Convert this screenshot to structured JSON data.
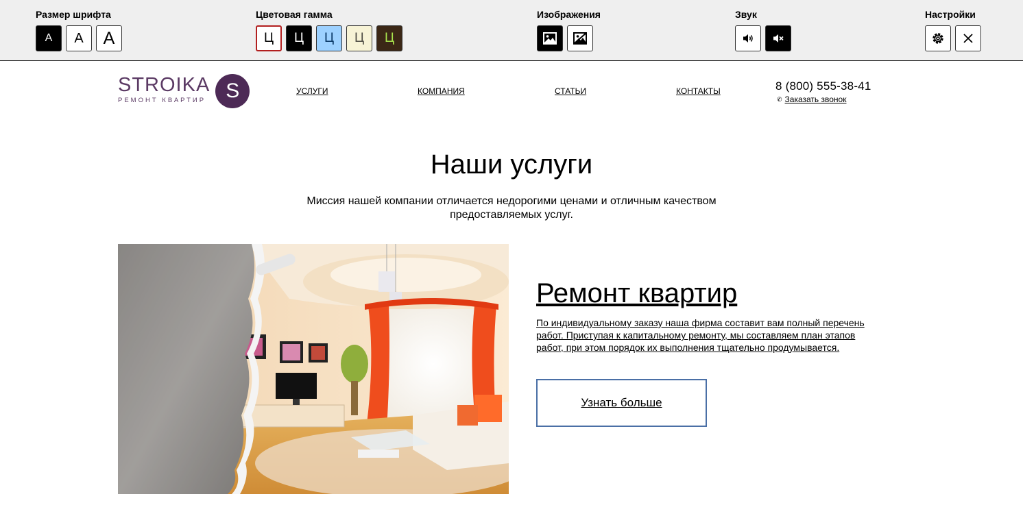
{
  "a11y_panel": {
    "font_size": {
      "title": "Размер шрифта",
      "buttons": [
        "A",
        "A",
        "A"
      ]
    },
    "color_scheme": {
      "title": "Цветовая гамма",
      "buttons": [
        {
          "label": "Ц",
          "bg": "#ffffff",
          "fg": "#000000"
        },
        {
          "label": "Ц",
          "bg": "#000000",
          "fg": "#ffffff"
        },
        {
          "label": "Ц",
          "bg": "#9dd1ff",
          "fg": "#063462"
        },
        {
          "label": "Ц",
          "bg": "#f7f3d6",
          "fg": "#4d4b43"
        },
        {
          "label": "Ц",
          "bg": "#3b2716",
          "fg": "#a9e44d"
        }
      ],
      "selected_border": "#b21f1f"
    },
    "images": {
      "title": "Изображения",
      "buttons": [
        "image-on-icon",
        "image-off-icon"
      ]
    },
    "sound": {
      "title": "Звук",
      "buttons": [
        "sound-on-icon",
        "sound-off-icon"
      ]
    },
    "settings": {
      "title": "Настройки",
      "buttons": [
        "gear-icon",
        "close-icon"
      ]
    }
  },
  "header": {
    "logo": {
      "word": "STROIKA",
      "subtitle": "РЕМОНТ КВАРТИР",
      "letter": "S",
      "brand_color": "#4d2a56"
    },
    "nav": [
      "УСЛУГИ",
      "КОМПАНИЯ",
      "СТАТЬИ",
      "КОНТАКТЫ"
    ],
    "phone": "8 (800) 555-38-41",
    "callback": "Заказать звонок"
  },
  "main": {
    "title": "Наши услуги",
    "mission": "Миссия нашей компании отличается недорогими ценами и отличным качеством предоставляемых услуг.",
    "service": {
      "title": "Ремонт квартир",
      "description": "По индивидуальному заказу наша фирма составит вам полный перечень работ. Приступая к капитальному ремонту, мы составляем план этапов работ, при этом порядок их выполнения тщательно продумывается.",
      "button": "Узнать больше",
      "button_border": "#4a6fa6"
    }
  }
}
